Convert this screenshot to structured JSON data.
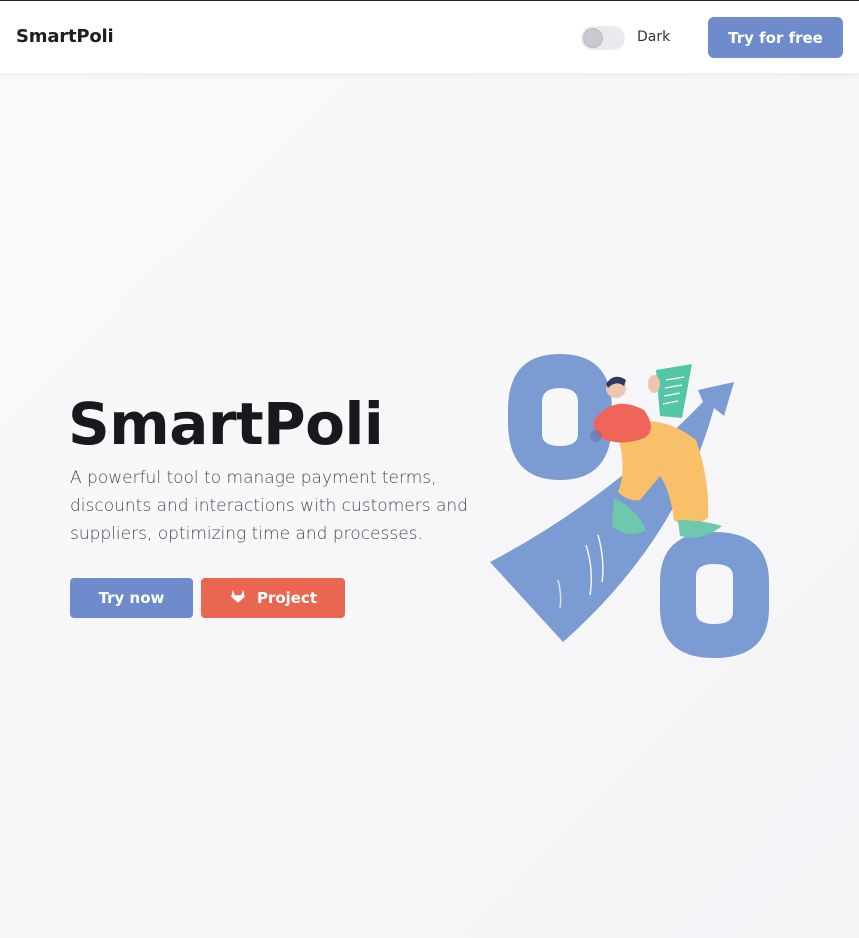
{
  "header": {
    "brand": "SmartPoli",
    "toggle_label": "Dark",
    "cta_label": "Try for free"
  },
  "hero": {
    "title": "SmartPoli",
    "description": "A powerful tool to manage payment terms, discounts and interactions with customers and suppliers, optimizing time and processes.",
    "primary_button": "Try now",
    "secondary_button": "Project",
    "secondary_icon": "gitlab-icon"
  },
  "theme": {
    "accent": "#6e8ccb",
    "secondary": "#e96751",
    "dark_mode": false
  }
}
